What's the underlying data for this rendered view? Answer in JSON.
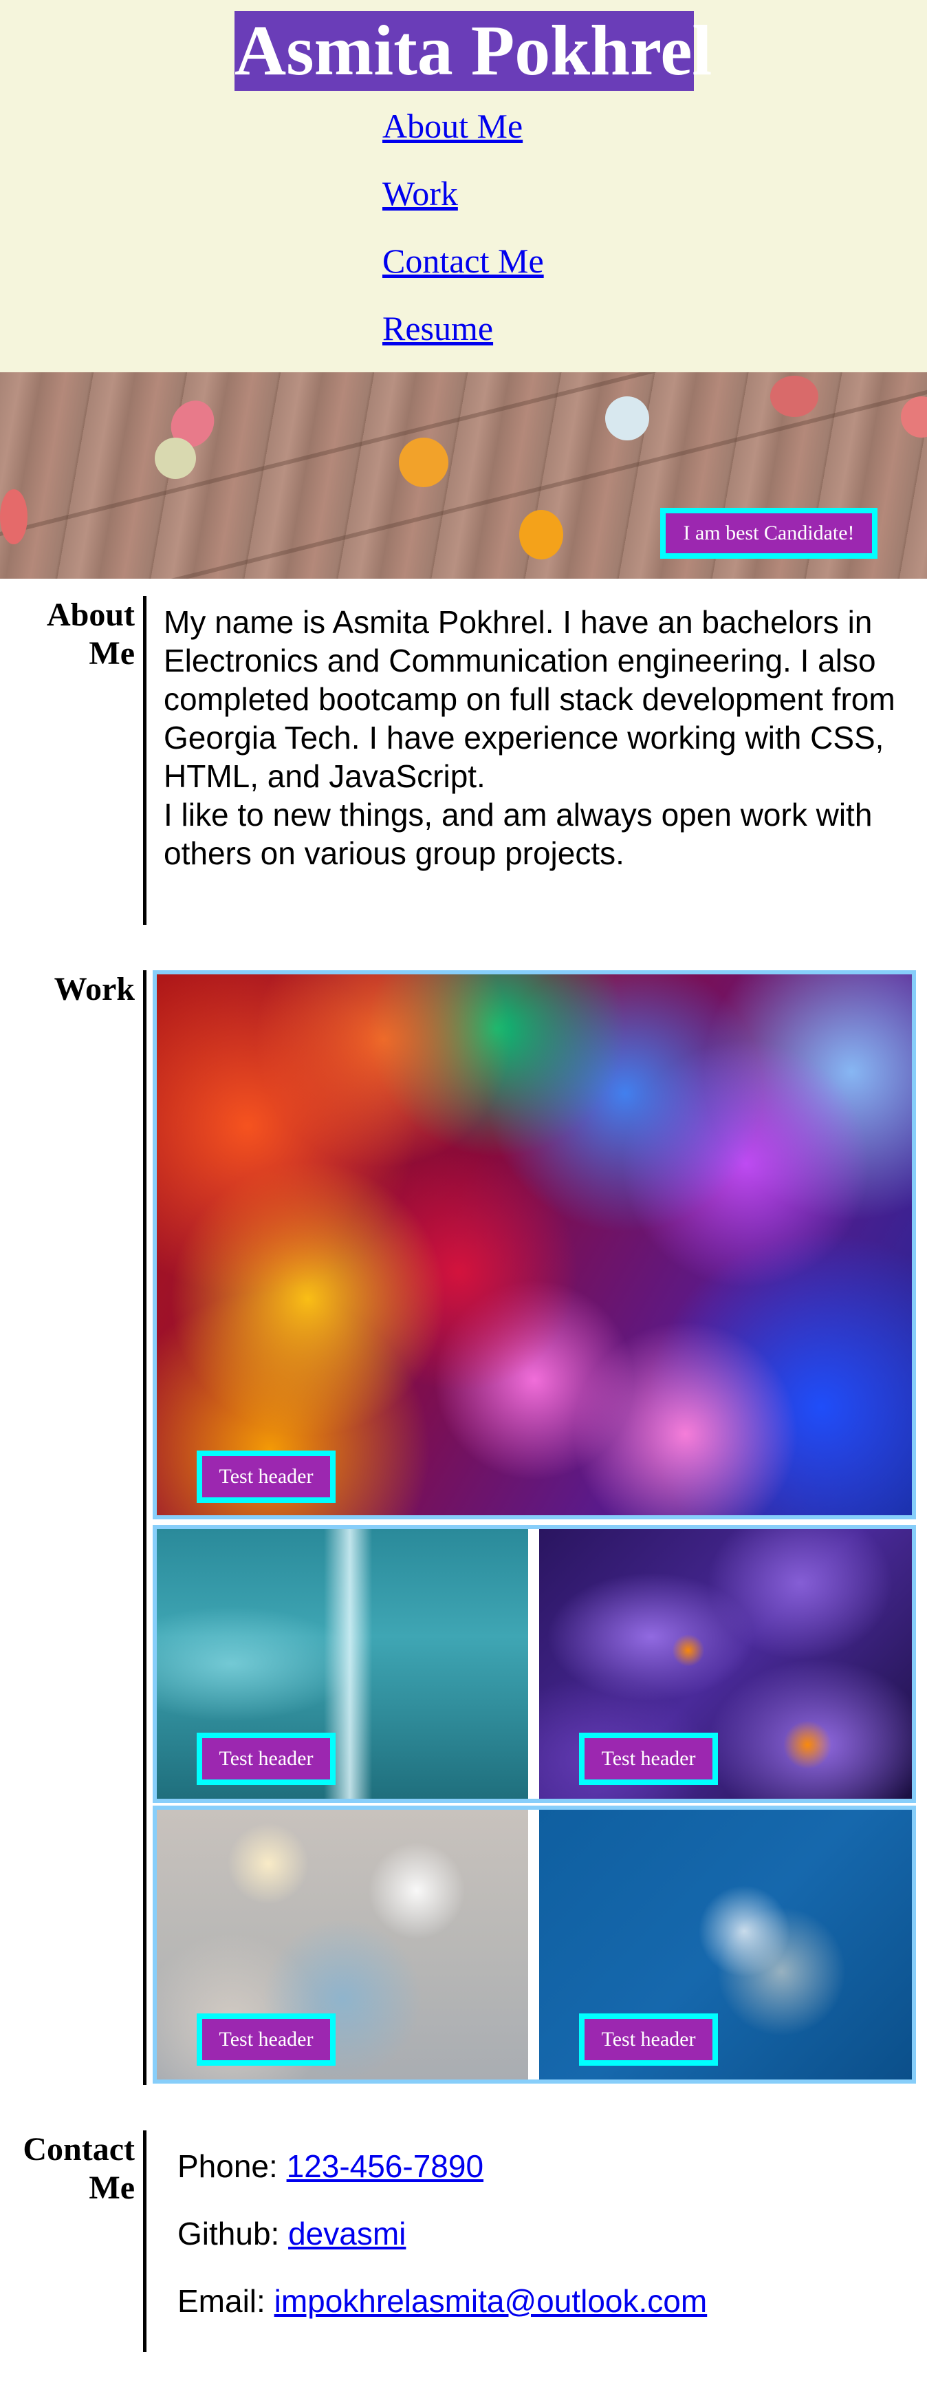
{
  "header": {
    "title": "Asmita Pokhrel",
    "nav": [
      {
        "label": "About Me"
      },
      {
        "label": "Work"
      },
      {
        "label": "Contact Me"
      },
      {
        "label": "Resume"
      }
    ]
  },
  "hero": {
    "badge": "I am best Candidate!"
  },
  "about": {
    "heading_line1": "About",
    "heading_line2": "Me",
    "paragraph1": "My name is Asmita Pokhrel. I have an bachelors in Electronics and Communication engineering. I also completed bootcamp on full stack development from Georgia Tech. I have experience working with CSS, HTML, and JavaScript.",
    "paragraph2": "I like to new things, and am always open work with others on various group projects."
  },
  "work": {
    "heading": "Work",
    "tiles": [
      {
        "label": "Test header"
      },
      {
        "label": "Test header"
      },
      {
        "label": "Test header"
      },
      {
        "label": "Test header"
      },
      {
        "label": "Test header"
      }
    ]
  },
  "contact": {
    "heading_line1": "Contact",
    "heading_line2": "Me",
    "items": [
      {
        "prefix": "Phone: ",
        "value": "123-456-7890"
      },
      {
        "prefix": "Github: ",
        "value": "devasmi"
      },
      {
        "prefix": "Email: ",
        "value": "impokhrelasmita@outlook.com"
      }
    ]
  },
  "colors": {
    "header_bg": "#f5f5dc",
    "title_bg": "#6a3db8",
    "badge_bg": "#9c27b0",
    "badge_border": "#00ffff",
    "work_border": "#87cefa",
    "link": "#0000ee"
  }
}
